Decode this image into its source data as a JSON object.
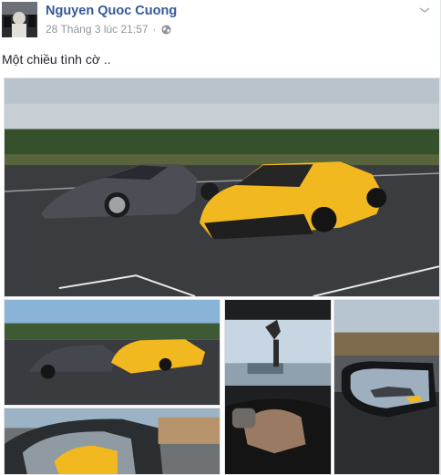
{
  "post": {
    "author": "Nguyen Quoc Cuong",
    "timestamp": "28 Tháng 3 lúc 21:57",
    "separator": "·",
    "privacy_icon": "globe-icon",
    "text": "Một chiều tình cờ .."
  },
  "colors": {
    "author_link": "#365899",
    "meta_gray": "#90949c",
    "car_yellow": "#f2b81f",
    "car_gray": "#4b4f55"
  },
  "photos": [
    {
      "subject": "yellow-and-gray-supercars-on-tarmac"
    },
    {
      "subject": "cars-side-by-side"
    },
    {
      "subject": "dashcam-view-from-driver-seat"
    },
    {
      "subject": "side-mirror-reflection"
    },
    {
      "subject": "mirror-with-yellow-car"
    }
  ]
}
